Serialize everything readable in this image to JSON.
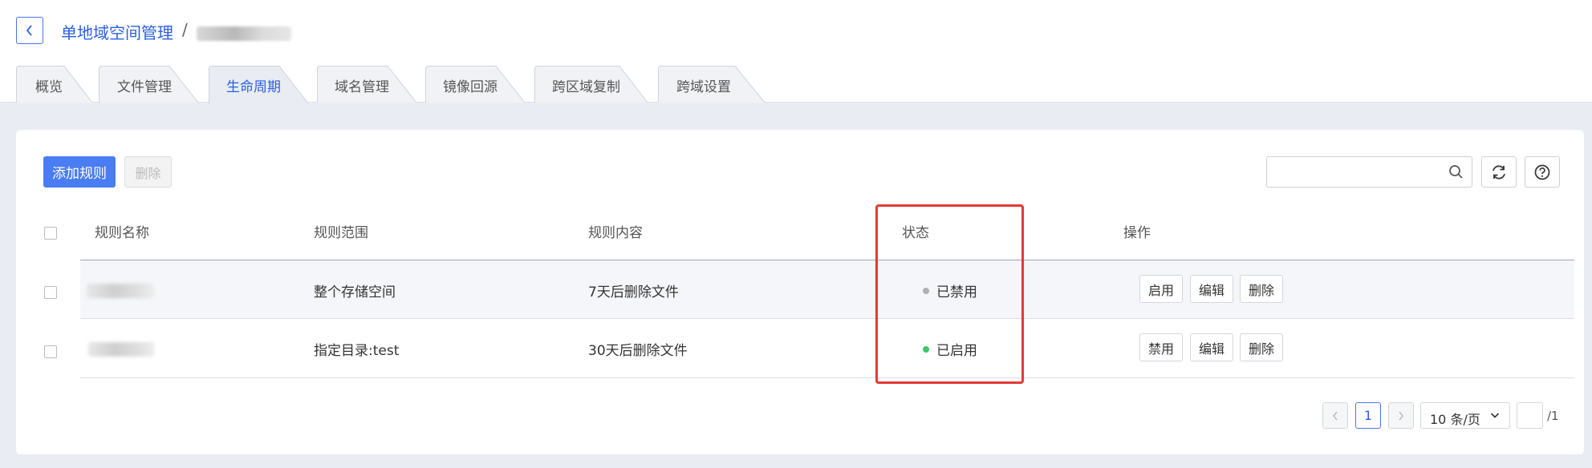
{
  "breadcrumb": {
    "parent": "单地域空间管理",
    "separator": "/"
  },
  "tabs": [
    {
      "label": "概览",
      "active": false
    },
    {
      "label": "文件管理",
      "active": false
    },
    {
      "label": "生命周期",
      "active": true
    },
    {
      "label": "域名管理",
      "active": false
    },
    {
      "label": "镜像回源",
      "active": false
    },
    {
      "label": "跨区域复制",
      "active": false
    },
    {
      "label": "跨域设置",
      "active": false
    }
  ],
  "toolbar": {
    "add_label": "添加规则",
    "delete_label": "删除",
    "search_placeholder": ""
  },
  "icons": {
    "back": "chevron-left-icon",
    "search": "search-icon",
    "refresh": "refresh-icon",
    "help": "help-icon",
    "page_size_arrow": "chevron-down-icon"
  },
  "table": {
    "headers": {
      "name": "规则名称",
      "scope": "规则范围",
      "content": "规则内容",
      "status": "状态",
      "actions": "操作"
    },
    "rows": [
      {
        "scope": "整个存储空间",
        "content": "7天后删除文件",
        "status": "已禁用",
        "status_color": "#b0b0b0",
        "toggle_label": "启用",
        "edit_label": "编辑",
        "delete_label": "删除"
      },
      {
        "scope": "指定目录:test",
        "content": "30天后删除文件",
        "status": "已启用",
        "status_color": "#3ac96a",
        "toggle_label": "禁用",
        "edit_label": "编辑",
        "delete_label": "删除"
      }
    ]
  },
  "pagination": {
    "current": "1",
    "page_size": "10 条/页",
    "jump_value": "",
    "total": "/1"
  },
  "colors": {
    "primary": "#4a7cf3",
    "link": "#2b5fe0",
    "highlight_box": "#e53935",
    "disabled_dot": "#b0b0b0",
    "enabled_dot": "#3ac96a"
  }
}
